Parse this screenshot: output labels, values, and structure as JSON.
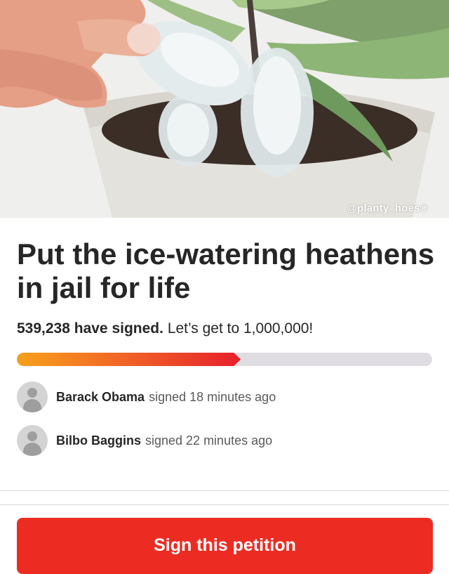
{
  "hero": {
    "image_description_icon": "photo-hand-ice-cubes-orchid-pot",
    "watermark": "@planty_hoes®"
  },
  "petition": {
    "title": "Put the ice-watering heathens in jail for life",
    "signed_count_text": "539,238 have signed.",
    "goal_text": "Let’s get to 1,000,000!",
    "signed_count": 539238,
    "goal": 1000000,
    "progress_fraction": 0.539238
  },
  "signers": [
    {
      "name": "Barack Obama",
      "action": "signed 18 minutes ago",
      "icon": "default-avatar-icon"
    },
    {
      "name": "Bilbo Baggins",
      "action": "signed 22 minutes ago",
      "icon": "default-avatar-icon"
    }
  ],
  "actions": {
    "sign_label": "Sign this petition"
  },
  "colors": {
    "button": "#ec2c22",
    "progress_start": "#f7a11c",
    "progress_end": "#e6202a",
    "progress_track": "#dfdde1",
    "text": "#262626"
  }
}
